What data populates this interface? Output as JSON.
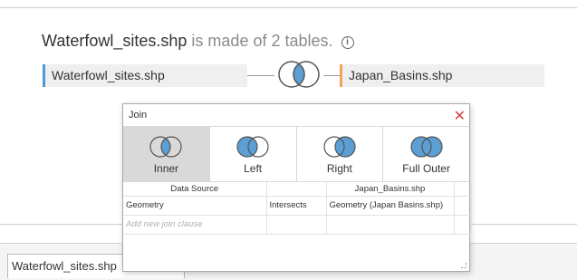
{
  "header": {
    "title_main": "Waterfowl_sites.shp",
    "title_rest": "is made of 2 tables.",
    "info_icon": "info-icon"
  },
  "tables": {
    "left": "Waterfowl_sites.shp",
    "right": "Japan_Basins.shp"
  },
  "colors": {
    "left_accent": "#4e9ad6",
    "right_accent": "#f2a55a",
    "venn_fill": "#5b9fd4",
    "close": "#d0433a"
  },
  "dialog": {
    "title": "Join",
    "close_icon": "close-icon",
    "join_types": [
      {
        "label": "Inner",
        "selected": true
      },
      {
        "label": "Left",
        "selected": false
      },
      {
        "label": "Right",
        "selected": false
      },
      {
        "label": "Full Outer",
        "selected": false
      }
    ],
    "columns": [
      "Data Source",
      "",
      "Japan_Basins.shp"
    ],
    "rows": [
      [
        "Geometry",
        "Intersects",
        "Geometry (Japan Basins.shp)"
      ]
    ],
    "add_placeholder": "Add new join clause"
  },
  "bottom": {
    "tab_label": "Waterfowl_sites.shp"
  }
}
